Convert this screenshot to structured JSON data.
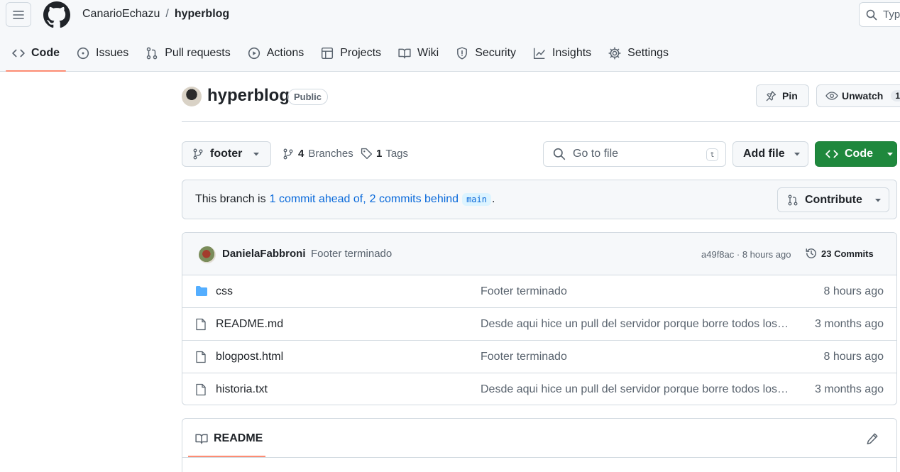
{
  "header": {
    "owner": "CanarioEchazu",
    "separator": "/",
    "repo": "hyperblog",
    "search_placeholder": "Type"
  },
  "nav": {
    "tabs": [
      {
        "label": "Code",
        "icon": "code-icon",
        "selected": true
      },
      {
        "label": "Issues",
        "icon": "issue-icon"
      },
      {
        "label": "Pull requests",
        "icon": "pull-request-icon"
      },
      {
        "label": "Actions",
        "icon": "play-icon"
      },
      {
        "label": "Projects",
        "icon": "table-icon"
      },
      {
        "label": "Wiki",
        "icon": "book-icon"
      },
      {
        "label": "Security",
        "icon": "shield-icon"
      },
      {
        "label": "Insights",
        "icon": "graph-icon"
      },
      {
        "label": "Settings",
        "icon": "gear-icon"
      }
    ]
  },
  "repo": {
    "name": "hyperblog",
    "visibility": "Public",
    "pin_label": "Pin",
    "watch_label": "Unwatch",
    "watch_count": "1"
  },
  "branchbar": {
    "branch": "footer",
    "branches_count": "4",
    "branches_label": "Branches",
    "tags_count": "1",
    "tags_label": "Tags",
    "goto_placeholder": "Go to file",
    "goto_kbd": "t",
    "add_file_label": "Add file",
    "code_label": "Code"
  },
  "branch_info": {
    "prefix": "This branch is",
    "ahead": "1 commit ahead of,",
    "behind": "2 commits behind",
    "base": "main",
    "suffix": ".",
    "contribute_label": "Contribute"
  },
  "latest_commit": {
    "author": "DanielaFabbroni",
    "message": "Footer terminado",
    "meta": "a49f8ac · 8 hours ago",
    "commits_label": "23 Commits"
  },
  "files": [
    {
      "name": "css",
      "type": "folder",
      "commit": "Footer terminado",
      "date": "8 hours ago"
    },
    {
      "name": "README.md",
      "type": "file",
      "commit": "Desde aqui hice un pull del servidor porque borre todos los archivos",
      "date": "3 months ago"
    },
    {
      "name": "blogpost.html",
      "type": "file",
      "commit": "Footer terminado",
      "date": "8 hours ago"
    },
    {
      "name": "historia.txt",
      "type": "file",
      "commit": "Desde aqui hice un pull del servidor porque borre todos los archivos",
      "date": "3 months ago"
    }
  ],
  "readme": {
    "label": "README"
  },
  "colors": {
    "accent_green": "#1f883d",
    "link_blue": "#0969da",
    "tab_underline": "#fd8c73",
    "folder_blue": "#54aeff"
  }
}
